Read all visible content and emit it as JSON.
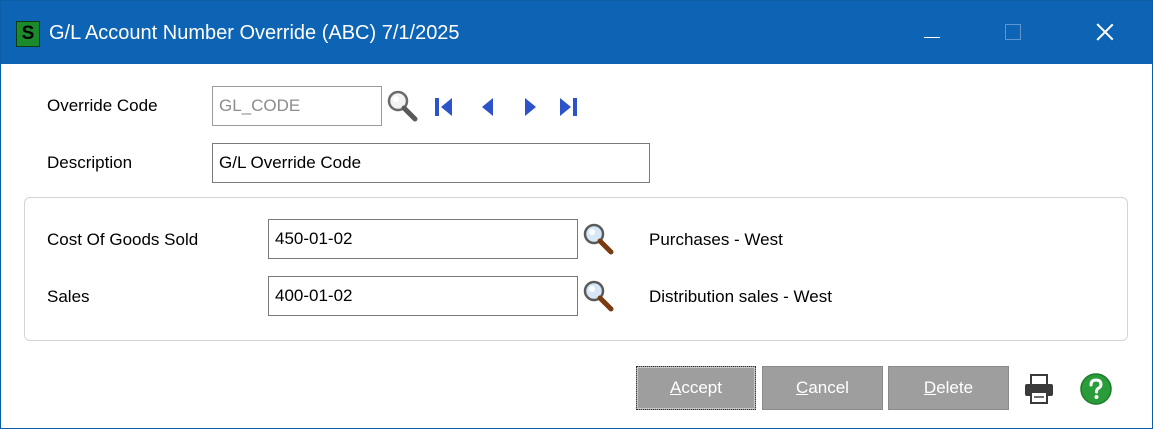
{
  "window": {
    "title": "G/L Account Number Override (ABC) 7/1/2025",
    "app_icon_letter": "S",
    "app_icon_color": "#1a8a2c",
    "titlebar_color": "#0d63b4"
  },
  "override_code": {
    "label": "Override Code",
    "value": "GL_CODE"
  },
  "description": {
    "label": "Description",
    "value": "G/L Override Code"
  },
  "accounts": {
    "cogs": {
      "label": "Cost Of Goods Sold",
      "value": "450-01-02",
      "account_name": "Purchases - West"
    },
    "sales": {
      "label": "Sales",
      "value": "400-01-02",
      "account_name": "Distribution sales - West"
    }
  },
  "buttons": {
    "accept": {
      "mnemonic": "A",
      "rest": "ccept"
    },
    "cancel": {
      "mnemonic": "C",
      "rest": "ancel"
    },
    "delete": {
      "mnemonic": "D",
      "rest": "elete"
    }
  },
  "icons": {
    "lookup": "magnifier-icon",
    "nav": [
      "first-record-icon",
      "previous-record-icon",
      "next-record-icon",
      "last-record-icon"
    ],
    "print": "printer-icon",
    "help": "help-icon"
  },
  "colors": {
    "nav_blue": "#2c53c9",
    "button_gray": "#9e9e9e",
    "help_green": "#2a9d3a"
  }
}
